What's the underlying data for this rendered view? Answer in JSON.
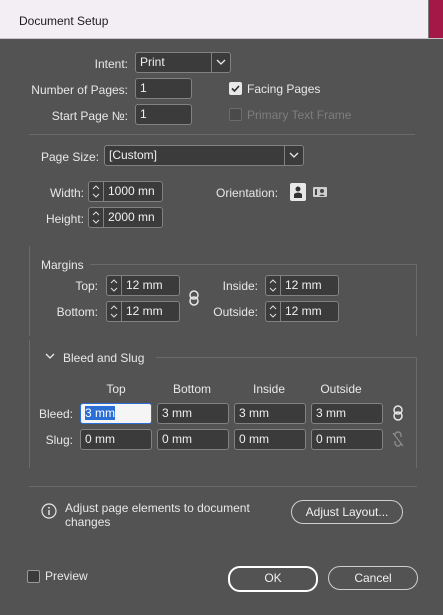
{
  "window": {
    "title": "Document Setup"
  },
  "intent": {
    "label": "Intent:",
    "value": "Print"
  },
  "pages": {
    "number_label": "Number of Pages:",
    "number_value": "1",
    "start_label": "Start Page №:",
    "start_value": "1",
    "facing_label": "Facing Pages",
    "facing_checked": true,
    "primary_label": "Primary Text Frame",
    "primary_checked": false
  },
  "page_size": {
    "label": "Page Size:",
    "value": "[Custom]",
    "width_label": "Width:",
    "width_value": "1000 mn",
    "height_label": "Height:",
    "height_value": "2000 mn",
    "orientation_label": "Orientation:"
  },
  "margins": {
    "title": "Margins",
    "top_label": "Top:",
    "top_value": "12 mm",
    "bottom_label": "Bottom:",
    "bottom_value": "12 mm",
    "inside_label": "Inside:",
    "inside_value": "12 mm",
    "outside_label": "Outside:",
    "outside_value": "12 mm"
  },
  "bleed_slug": {
    "title": "Bleed and Slug",
    "columns": [
      "Top",
      "Bottom",
      "Inside",
      "Outside"
    ],
    "bleed_label": "Bleed:",
    "bleed_values": [
      "3 mm",
      "3 mm",
      "3 mm",
      "3 mm"
    ],
    "slug_label": "Slug:",
    "slug_values": [
      "0 mm",
      "0 mm",
      "0 mm",
      "0 mm"
    ]
  },
  "info": {
    "text_line1": "Adjust page elements to document",
    "text_line2": "changes",
    "button": "Adjust Layout..."
  },
  "footer": {
    "preview_label": "Preview",
    "ok": "OK",
    "cancel": "Cancel"
  }
}
